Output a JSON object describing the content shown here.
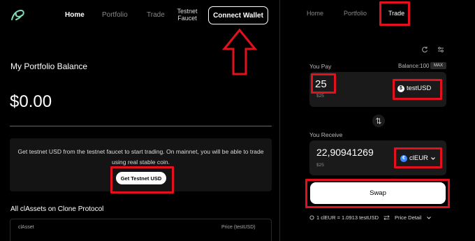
{
  "left_nav": {
    "home": "Home",
    "portfolio": "Portfolio",
    "trade": "Trade",
    "faucet_line1": "Testnet",
    "faucet_line2": "Faucet",
    "connect_wallet": "Connect Wallet"
  },
  "portfolio": {
    "title": "My Portfolio Balance",
    "balance": "$0.00"
  },
  "faucet_card": {
    "text": "Get testnet USD from the testnet faucet to start trading. On mainnet, you will be able to trade using real stable coin.",
    "button": "Get Testnet USD"
  },
  "assets": {
    "title": "All clAssets on Clone Protocol",
    "columns": [
      "clAsset",
      "Price (testUSD)"
    ]
  },
  "right_nav": {
    "home": "Home",
    "portfolio": "Portfolio",
    "trade": "Trade"
  },
  "trade": {
    "pay_label": "You Pay",
    "balance_label": "Balance:100",
    "max": "MAX",
    "pay_amount": "25",
    "pay_usd": "$25",
    "pay_token": "testUSD",
    "receive_label": "You Receive",
    "receive_amount": "22,90941269",
    "receive_usd": "$25",
    "receive_token": "clEUR",
    "swap": "Swap",
    "rate": "1 clEUR = 1.0913 testUSD",
    "price_detail": "Price Detail"
  },
  "colors": {
    "annotation": "#e3101e",
    "background": "#000000",
    "card": "#1a1a1a"
  },
  "icons": [
    "logo-icon",
    "up-arrow-icon",
    "refresh-icon",
    "settings-sliders-icon",
    "testusd-coin-icon",
    "cleur-coin-icon",
    "chevron-down-icon",
    "swap-direction-icon",
    "info-circle-icon",
    "exchange-arrows-icon"
  ]
}
